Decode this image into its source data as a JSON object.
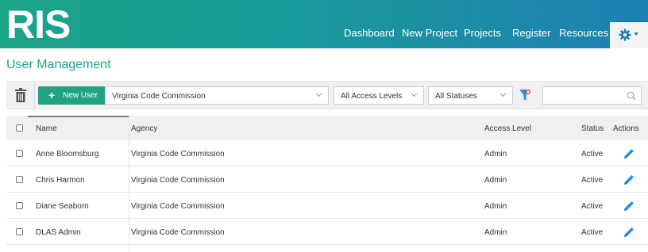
{
  "header": {
    "logo": "RIS",
    "nav": [
      "Dashboard",
      "New Project",
      "Projects",
      "Register",
      "Resources"
    ],
    "settings_icon": "gear-icon",
    "brand_gradient": [
      "#1aa487",
      "#1e7fb3"
    ]
  },
  "page_title": "User Management",
  "toolbar": {
    "delete_icon": "trash-icon",
    "new_user_label": "New User",
    "agency_filter": "Virginia Code Commission",
    "access_filter": "All Access Levels",
    "status_filter": "All Statuses",
    "clear_filter_icon": "filter-icon",
    "search_value": "",
    "search_icon": "search-icon"
  },
  "table": {
    "columns": [
      "Name",
      "Agency",
      "Access Level",
      "Status",
      "Actions"
    ],
    "rows": [
      {
        "name": "Anne Bloomsburg",
        "agency": "Virginia Code Commission",
        "access": "Admin",
        "status": "Active"
      },
      {
        "name": "Chris Harmon",
        "agency": "Virginia Code Commission",
        "access": "Admin",
        "status": "Active"
      },
      {
        "name": "Diane Seaborn",
        "agency": "Virginia Code Commission",
        "access": "Admin",
        "status": "Active"
      },
      {
        "name": "DLAS Admin",
        "agency": "Virginia Code Commission",
        "access": "Admin",
        "status": "Active"
      }
    ],
    "edit_icon": "pencil-icon",
    "accent_color": "#2b8fd6"
  }
}
